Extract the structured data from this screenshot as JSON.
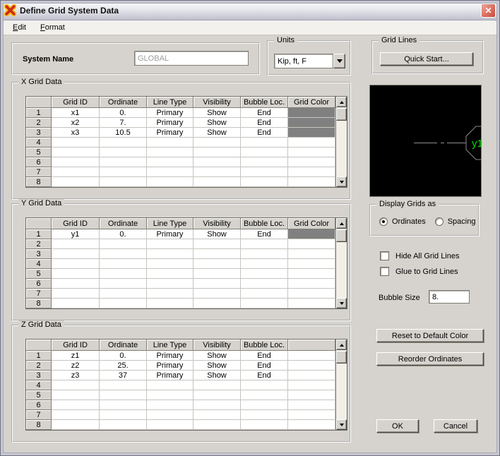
{
  "window": {
    "title": "Define Grid System Data"
  },
  "menu": {
    "items": [
      "Edit",
      "Format"
    ]
  },
  "header": {
    "system_name_label": "System Name",
    "system_name_value": "GLOBAL",
    "units_label": "Units",
    "units_value": "Kip, ft, F",
    "grid_lines_label": "Grid Lines",
    "quick_start_label": "Quick Start..."
  },
  "tables": [
    {
      "group_label": "X Grid Data",
      "columns": [
        "",
        "Grid ID",
        "Ordinate",
        "Line Type",
        "Visibility",
        "Bubble Loc.",
        "Grid Color"
      ],
      "rows": [
        [
          "x1",
          "0.",
          "Primary",
          "Show",
          "End",
          "#808080"
        ],
        [
          "x2",
          "7.",
          "Primary",
          "Show",
          "End",
          "#808080"
        ],
        [
          "x3",
          "10.5",
          "Primary",
          "Show",
          "End",
          "#808080"
        ]
      ],
      "visible_rows": 8
    },
    {
      "group_label": "Y Grid Data",
      "columns": [
        "",
        "Grid ID",
        "Ordinate",
        "Line Type",
        "Visibility",
        "Bubble Loc.",
        "Grid Color"
      ],
      "rows": [
        [
          "y1",
          "0.",
          "Primary",
          "Show",
          "End",
          "#808080"
        ]
      ],
      "visible_rows": 8
    },
    {
      "group_label": "Z Grid Data",
      "columns": [
        "",
        "Grid ID",
        "Ordinate",
        "Line Type",
        "Visibility",
        "Bubble Loc.",
        ""
      ],
      "rows": [
        [
          "z1",
          "0.",
          "Primary",
          "Show",
          "End",
          ""
        ],
        [
          "z2",
          "25.",
          "Primary",
          "Show",
          "End",
          ""
        ],
        [
          "z3",
          "37",
          "Primary",
          "Show",
          "End",
          ""
        ]
      ],
      "visible_rows": 8
    }
  ],
  "preview": {
    "bubble_label": "y1",
    "bubble_text_color": "#00DD00",
    "line_color": "#8C8C8C",
    "background": "#000000"
  },
  "display_grids": {
    "group_label": "Display Grids as",
    "options": [
      {
        "label": "Ordinates",
        "selected": true
      },
      {
        "label": "Spacing",
        "selected": false
      }
    ]
  },
  "options": {
    "hide_label": "Hide All Grid Lines",
    "hide_checked": false,
    "glue_label": "Glue to Grid Lines",
    "glue_checked": false,
    "bubble_size_label": "Bubble Size",
    "bubble_size_value": "8."
  },
  "buttons": {
    "reset_color": "Reset to Default Color",
    "reorder": "Reorder Ordinates",
    "ok": "OK",
    "cancel": "Cancel"
  },
  "colors": {
    "dialog_bg": "#D6D3CE",
    "grid_swatch": "#808080",
    "close_button": "#D0584A"
  }
}
